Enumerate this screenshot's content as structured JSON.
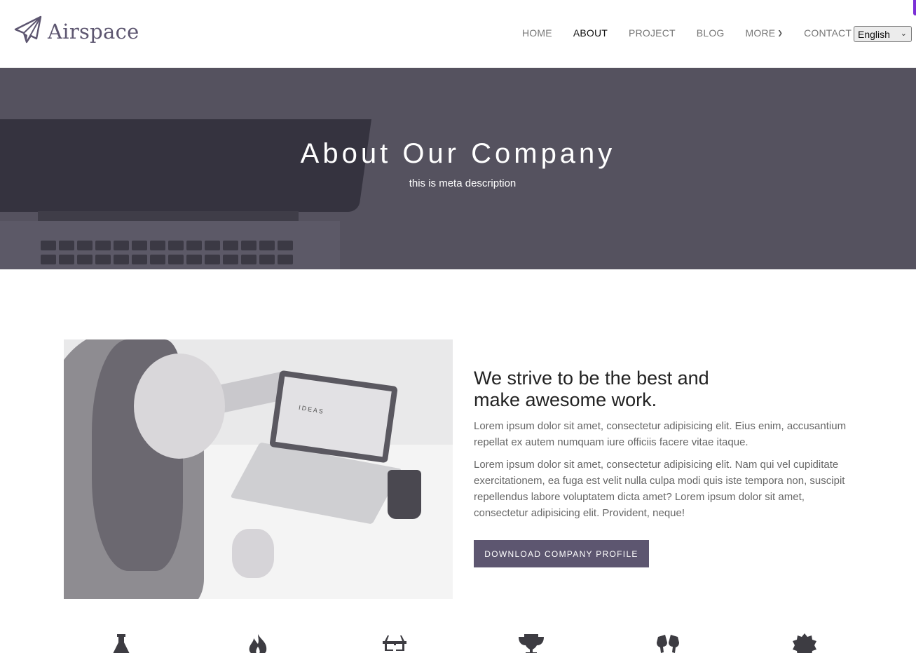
{
  "brand": {
    "name": "Airspace"
  },
  "nav": {
    "items": [
      {
        "label": "HOME",
        "active": false
      },
      {
        "label": "ABOUT",
        "active": true
      },
      {
        "label": "PROJECT",
        "active": false
      },
      {
        "label": "BLOG",
        "active": false
      },
      {
        "label": "MORE",
        "active": false,
        "has_dropdown": true
      },
      {
        "label": "CONTACT",
        "active": false
      }
    ],
    "language": "English"
  },
  "hero": {
    "title": "About Our Company",
    "subtitle": "this is meta description"
  },
  "about": {
    "image_caption": "IDEAS",
    "heading_line1": "We strive to be the best and",
    "heading_line2": "make awesome work.",
    "paragraph1": "Lorem ipsum dolor sit amet, consectetur adipisicing elit. Eius enim, accusantium repellat ex autem numquam iure officiis facere vitae itaque.",
    "paragraph2": "Lorem ipsum dolor sit amet, consectetur adipisicing elit. Nam qui vel cupiditate exercitationem, ea fuga est velit nulla culpa modi quis iste tempora non, suscipit repellendus labore voluptatem dicta amet? Lorem ipsum dolor sit amet, consectetur adipisicing elit. Provident, neque!",
    "button_label": "DOWNLOAD COMPANY PROFILE"
  },
  "feature_icons": [
    "flask-icon",
    "fire-icon",
    "glasses-icon",
    "trophy-icon",
    "cheers-icon",
    "badge-icon"
  ],
  "colors": {
    "accent": "#5d5670",
    "hero_overlay": "#55525f",
    "text_dark": "#222222",
    "text_muted": "#666666"
  }
}
